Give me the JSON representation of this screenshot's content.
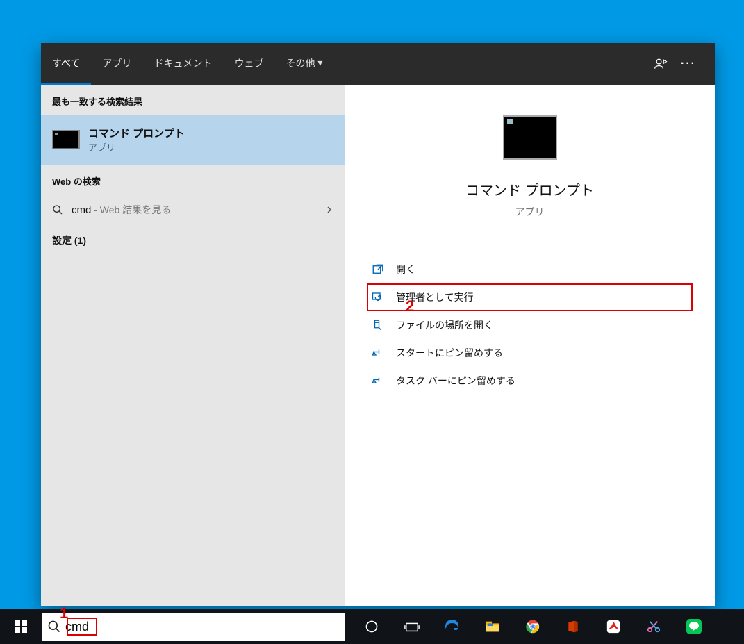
{
  "tabs": {
    "all": "すべて",
    "apps": "アプリ",
    "documents": "ドキュメント",
    "web": "ウェブ",
    "more": "その他"
  },
  "left": {
    "bestMatchHeader": "最も一致する検索結果",
    "bestMatch": {
      "title": "コマンド プロンプト",
      "subtitle": "アプリ"
    },
    "webHeader": "Web の検索",
    "webRow": {
      "query": "cmd",
      "hint": " - Web 結果を見る"
    },
    "settings": "設定 (1)"
  },
  "right": {
    "title": "コマンド プロンプト",
    "subtitle": "アプリ",
    "actions": {
      "open": "開く",
      "runAdmin": "管理者として実行",
      "openLocation": "ファイルの場所を開く",
      "pinStart": "スタートにピン留めする",
      "pinTaskbar": "タスク バーにピン留めする"
    }
  },
  "search": {
    "value": "cmd"
  },
  "annotations": {
    "one": "1",
    "two": "2"
  }
}
